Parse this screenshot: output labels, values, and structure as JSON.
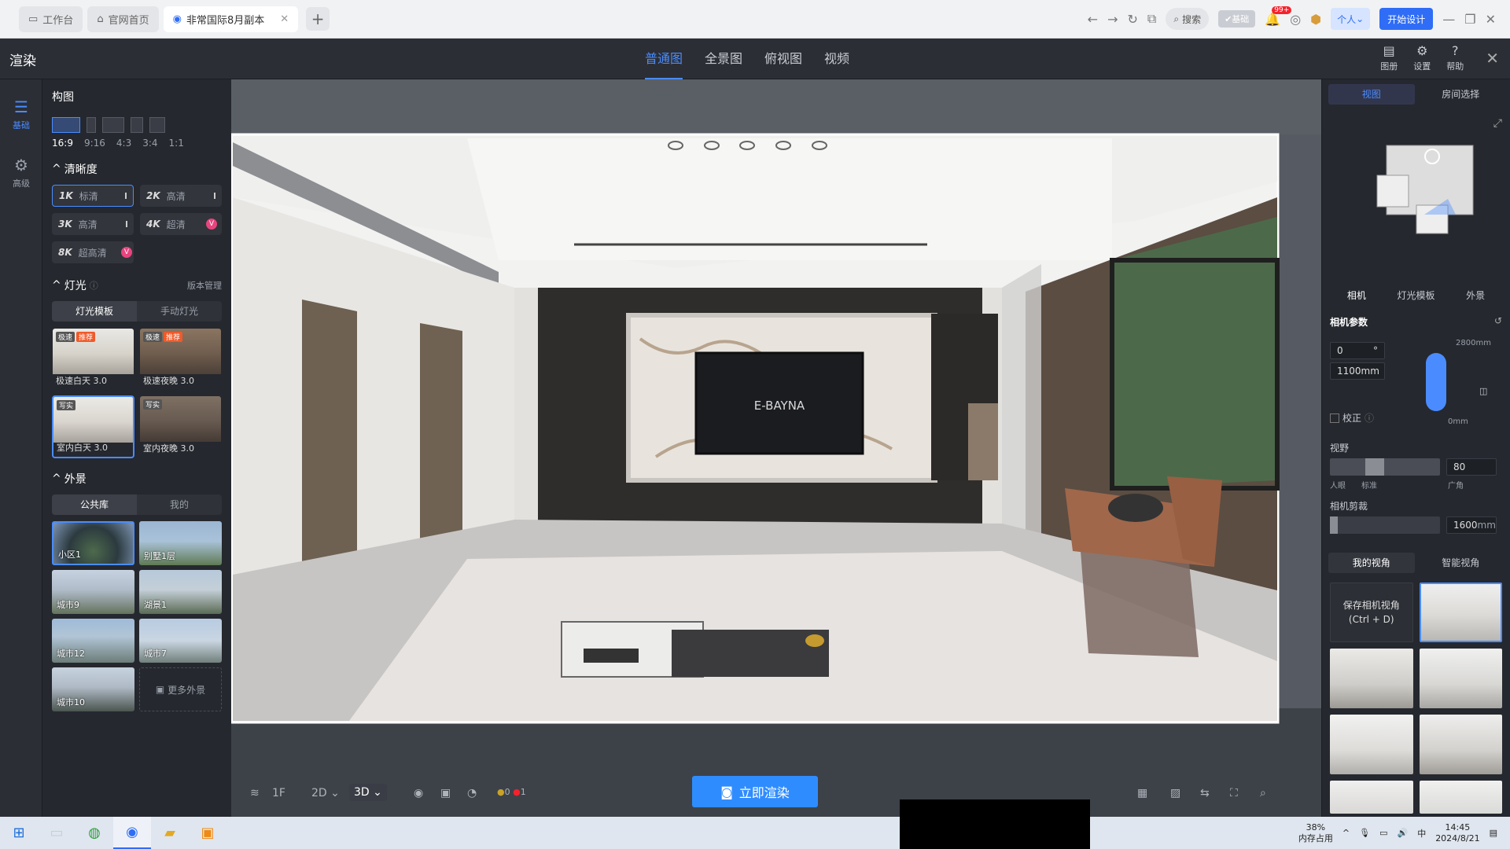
{
  "browser": {
    "tabs": [
      {
        "label": "工作台",
        "icon": "desk-icon"
      },
      {
        "label": "官网首页",
        "icon": "home-icon"
      },
      {
        "label": "非常国际8月副本",
        "icon": "design-icon",
        "active": true
      }
    ],
    "search_label": "搜索",
    "vip_label": "基础",
    "notif_badge": "99+",
    "personal_label": "个人",
    "start_label": "开始设计"
  },
  "header": {
    "title": "渲染",
    "view_tabs": [
      "普通图",
      "全景图",
      "俯视图",
      "视频"
    ],
    "active_tab": 0,
    "buttons": [
      {
        "label": "图册",
        "icon": "album-icon"
      },
      {
        "label": "设置",
        "icon": "gear-icon"
      },
      {
        "label": "帮助",
        "icon": "help-icon"
      }
    ]
  },
  "rail": [
    {
      "label": "基础",
      "icon": "sliders-icon",
      "active": true
    },
    {
      "label": "高级",
      "icon": "settings-icon"
    }
  ],
  "left_panel": {
    "composition_title": "构图",
    "ratios": [
      "16:9",
      "9:16",
      "4:3",
      "3:4",
      "1:1"
    ],
    "clarity_title": "清晰度",
    "resolutions": [
      {
        "code": "1K",
        "label": "标清",
        "active": true
      },
      {
        "code": "2K",
        "label": "高清"
      },
      {
        "code": "3K",
        "label": "高清"
      },
      {
        "code": "4K",
        "label": "超清",
        "vip": true
      },
      {
        "code": "8K",
        "label": "超高清",
        "vip": true
      }
    ],
    "light_title": "灯光",
    "version_mgmt": "版本管理",
    "light_modes": [
      "灯光模板",
      "手动灯光"
    ],
    "light_templates": [
      {
        "label": "极速白天 3.0",
        "tags": [
          "极速",
          "推荐"
        ]
      },
      {
        "label": "极速夜晚 3.0",
        "tags": [
          "极速",
          "推荐"
        ]
      },
      {
        "label": "室内白天 3.0",
        "tags": [
          "写实"
        ],
        "active": true
      },
      {
        "label": "室内夜晚 3.0",
        "tags": [
          "写实"
        ]
      }
    ],
    "exterior_title": "外景",
    "exterior_modes": [
      "公共库",
      "我的"
    ],
    "exteriors": [
      "小区1",
      "别墅1层",
      "城市9",
      "湖景1",
      "城市12",
      "城市7",
      "城市10"
    ],
    "more_exterior": "更多外景"
  },
  "viewport": {
    "tv_text": "E-BAYNA",
    "floor": "1F",
    "mode_2d": "2D",
    "mode_3d": "3D",
    "count_a": "0",
    "count_b": "1",
    "render_button": "立即渲染"
  },
  "right_panel": {
    "top_tabs": [
      "视图",
      "房间选择"
    ],
    "camera_tabs": [
      "相机",
      "灯光模板",
      "外景"
    ],
    "camera_params_title": "相机参数",
    "angle_value": "0",
    "angle_unit": "°",
    "height_value": "1100mm",
    "height_max": "2800mm",
    "height_min": "0mm",
    "calibrate_label": "校正",
    "fov_title": "视野",
    "fov_value": "80",
    "fov_labels": [
      "人眼",
      "标准",
      "广角"
    ],
    "clip_title": "相机剪裁",
    "clip_value": "1600",
    "clip_unit": "mm",
    "view_tabs": [
      "我的视角",
      "智能视角"
    ],
    "save_camera": "保存相机视角",
    "save_shortcut": "(Ctrl + D)"
  },
  "taskbar": {
    "memory_percent": "38%",
    "memory_label": "内存占用",
    "time": "14:45",
    "date": "2024/8/21"
  }
}
